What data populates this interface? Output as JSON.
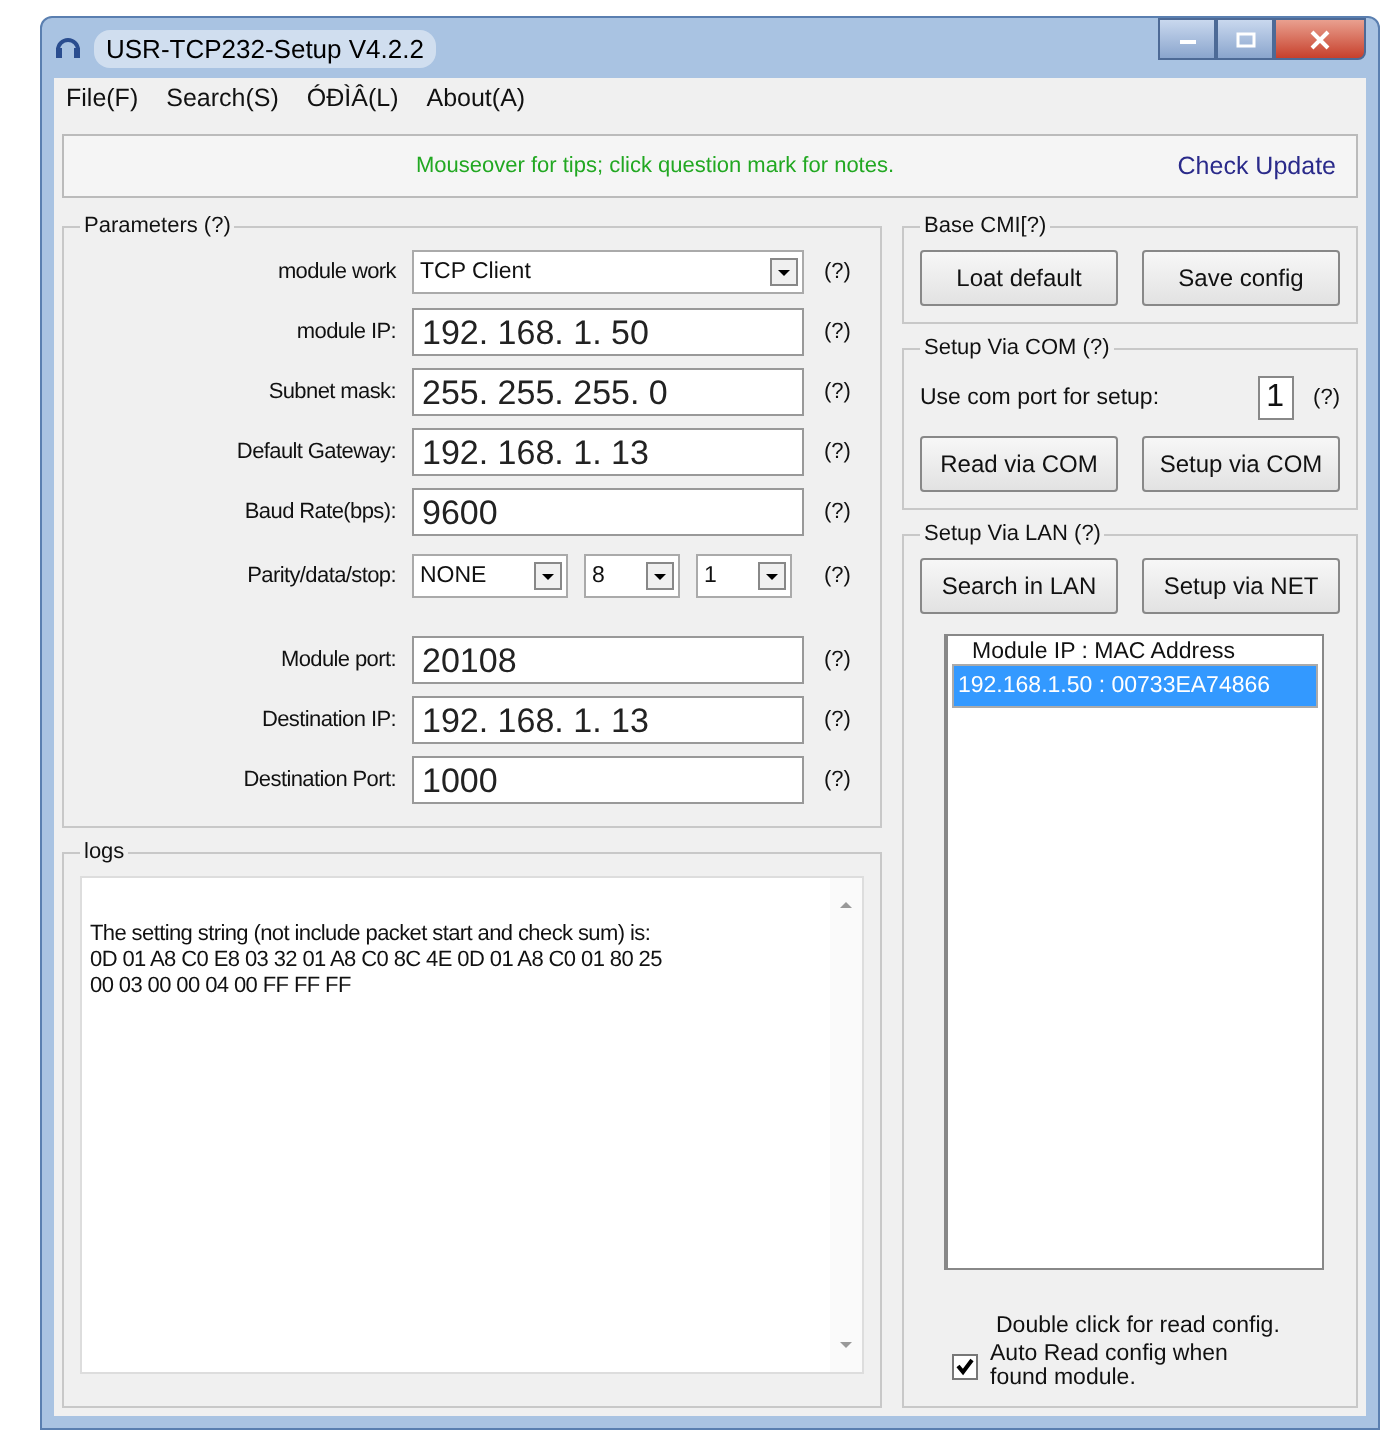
{
  "window": {
    "title": "USR-TCP232-Setup V4.2.2"
  },
  "menu": [
    {
      "label": "File(F)"
    },
    {
      "label": "Search(S)"
    },
    {
      "label": "ÓÐÌÂ(L)"
    },
    {
      "label": "About(A)"
    }
  ],
  "tip_bar": {
    "text": "Mouseover for tips; click question mark for notes.",
    "link": "Check Update"
  },
  "parameters": {
    "title": "Parameters",
    "help": "(?)",
    "rows": [
      {
        "kind": "select",
        "label": "module work",
        "values": [
          "TCP Client"
        ],
        "help": "(?)"
      },
      {
        "kind": "input",
        "label": "module IP:",
        "values": [
          "192. 168. 1. 50"
        ],
        "help": "(?)"
      },
      {
        "kind": "input",
        "label": "Subnet mask:",
        "values": [
          "255. 255. 255. 0"
        ],
        "help": "(?)"
      },
      {
        "kind": "input",
        "label": "Default Gateway:",
        "values": [
          "192. 168. 1. 13"
        ],
        "help": "(?)"
      },
      {
        "kind": "input",
        "label": "Baud Rate(bps):",
        "values": [
          "9600"
        ],
        "help": "(?)"
      },
      {
        "kind": "multi",
        "label": "Parity/data/stop:",
        "values": [
          "NONE",
          "8",
          "1"
        ],
        "help": "(?)"
      },
      {
        "kind": "input",
        "label": "Module port:",
        "values": [
          "20108"
        ],
        "help": "(?)"
      },
      {
        "kind": "input",
        "label": "Destination IP:",
        "values": [
          "192. 168. 1. 13"
        ],
        "help": "(?)"
      },
      {
        "kind": "input",
        "label": "Destination Port:",
        "values": [
          "1000"
        ],
        "help": "(?)"
      }
    ]
  },
  "logs": {
    "title": "logs",
    "lines": [
      "The setting string (not include packet start and check sum) is:",
      "0D 01 A8 C0 E8 03 32 01 A8 C0 8C 4E 0D 01 A8 C0 01 80 25",
      "00 03 00 00 04 00 FF FF FF"
    ]
  },
  "base_cmd": {
    "title": "Base CMI[?)",
    "buttons": [
      "Loat default",
      "Save config"
    ]
  },
  "setup_com": {
    "title": "Setup Via COM",
    "help": "(?)",
    "port_label": "Use com port for setup:",
    "port": "1",
    "port_help": "(?)",
    "buttons": [
      "Read via COM",
      "Setup via COM"
    ]
  },
  "setup_lan": {
    "title": "Setup Via LAN",
    "help": "(?)",
    "buttons": [
      "Search in LAN",
      "Setup via NET"
    ],
    "list": {
      "header": "Module IP  :  MAC Address",
      "rows": [
        {
          "text": "192.168.1.50 : 00733EA74866",
          "selected": true
        }
      ]
    },
    "note": "Double click for read config.",
    "auto_read": {
      "label": "Auto Read config when found module.",
      "checked": true
    }
  }
}
